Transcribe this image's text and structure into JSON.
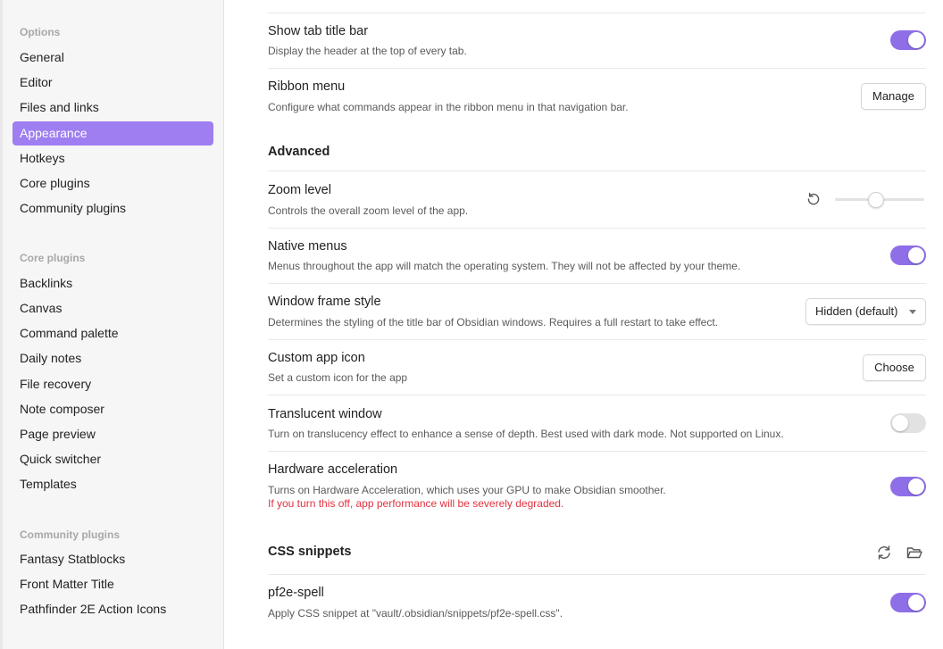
{
  "sidebar": {
    "options_heading": "Options",
    "options": [
      "General",
      "Editor",
      "Files and links",
      "Appearance",
      "Hotkeys",
      "Core plugins",
      "Community plugins"
    ],
    "active_item": "Appearance",
    "core_heading": "Core plugins",
    "core": [
      "Backlinks",
      "Canvas",
      "Command palette",
      "Daily notes",
      "File recovery",
      "Note composer",
      "Page preview",
      "Quick switcher",
      "Templates"
    ],
    "community_heading": "Community plugins",
    "community": [
      "Fantasy Statblocks",
      "Front Matter Title",
      "Pathfinder 2E Action Icons"
    ]
  },
  "settings": {
    "show_tab_title_bar": {
      "name": "Show tab title bar",
      "desc": "Display the header at the top of every tab.",
      "enabled": true
    },
    "ribbon_menu": {
      "name": "Ribbon menu",
      "desc": "Configure what commands appear in the ribbon menu in that navigation bar.",
      "button": "Manage"
    },
    "advanced_heading": "Advanced",
    "zoom_level": {
      "name": "Zoom level",
      "desc": "Controls the overall zoom level of the app.",
      "reset_icon": "reset-icon",
      "slider_fraction": 0.46
    },
    "native_menus": {
      "name": "Native menus",
      "desc": "Menus throughout the app will match the operating system. They will not be affected by your theme.",
      "enabled": true
    },
    "window_frame_style": {
      "name": "Window frame style",
      "desc": "Determines the styling of the title bar of Obsidian windows. Requires a full restart to take effect.",
      "value": "Hidden (default)"
    },
    "custom_app_icon": {
      "name": "Custom app icon",
      "desc": "Set a custom icon for the app",
      "button": "Choose"
    },
    "translucent_window": {
      "name": "Translucent window",
      "desc": "Turn on translucency effect to enhance a sense of depth. Best used with dark mode. Not supported on Linux.",
      "enabled": false
    },
    "hardware_acceleration": {
      "name": "Hardware acceleration",
      "desc": "Turns on Hardware Acceleration, which uses your GPU to make Obsidian smoother.",
      "warning": "If you turn this off, app performance will be severely degraded.",
      "enabled": true
    },
    "css_snippets_heading": "CSS snippets",
    "snippet": {
      "name": "pf2e-spell",
      "desc": "Apply CSS snippet at \"vault/.obsidian/snippets/pf2e-spell.css\".",
      "enabled": true
    }
  },
  "colors": {
    "accent": "#8f6fe8",
    "sidebar_active": "#9e7ef0",
    "warning": "#e0323f"
  }
}
